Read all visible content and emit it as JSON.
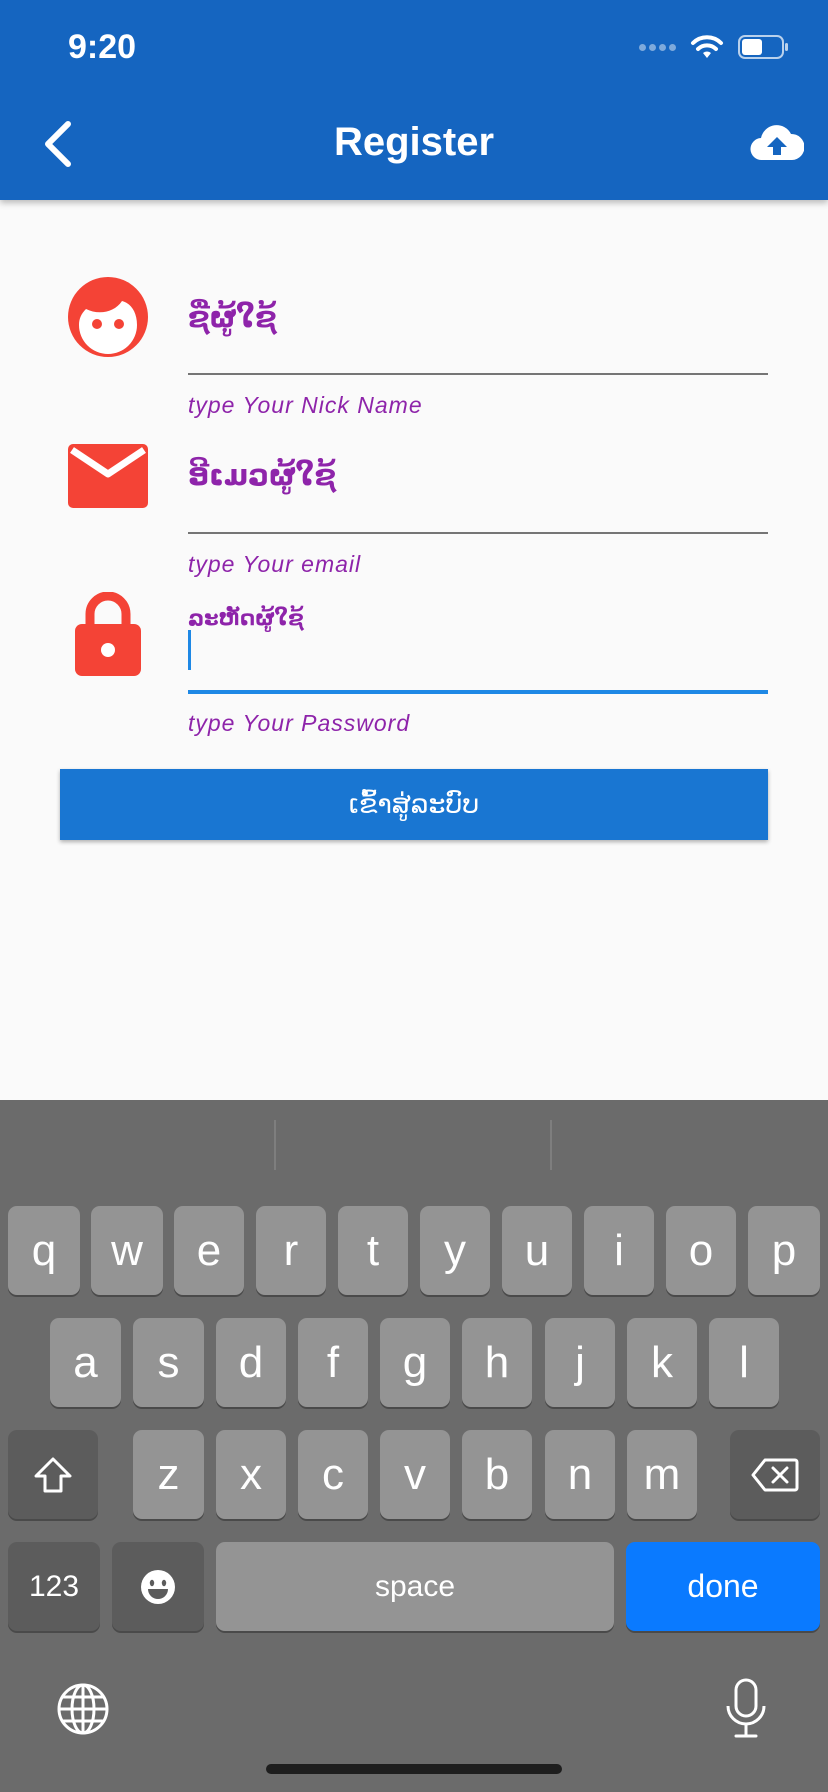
{
  "status_bar": {
    "time": "9:20"
  },
  "app_bar": {
    "title": "Register",
    "back_icon": "chevron-left-icon",
    "action_icon": "cloud-upload-icon"
  },
  "form": {
    "nickname": {
      "label": "ຊື່ຜູ້ໃຊ້",
      "helper": "type Your Nick Name",
      "icon": "face-icon",
      "icon_color": "#f44336"
    },
    "email": {
      "label": "ອີເມວຜູ້ໃຊ້",
      "helper": "type Your email",
      "icon": "mail-icon",
      "icon_color": "#f44336"
    },
    "password": {
      "label": "ລະຫັດຜູ້ໃຊ້",
      "helper": "type Your Password",
      "icon": "lock-icon",
      "icon_color": "#f44336",
      "focused": true
    }
  },
  "login_button": {
    "label": "ເຂົ້າສູ່ລະບົບ"
  },
  "keyboard": {
    "row1": [
      "q",
      "w",
      "e",
      "r",
      "t",
      "y",
      "u",
      "i",
      "o",
      "p"
    ],
    "row2": [
      "a",
      "s",
      "d",
      "f",
      "g",
      "h",
      "j",
      "k",
      "l"
    ],
    "row3": [
      "z",
      "x",
      "c",
      "v",
      "b",
      "n",
      "m"
    ],
    "num_key": "123",
    "space_key": "space",
    "done_key": "done"
  },
  "colors": {
    "primary": "#1565c0",
    "button": "#1976d2",
    "accent_text": "#8e24aa",
    "icon": "#f44336",
    "done": "#0a7aff"
  }
}
